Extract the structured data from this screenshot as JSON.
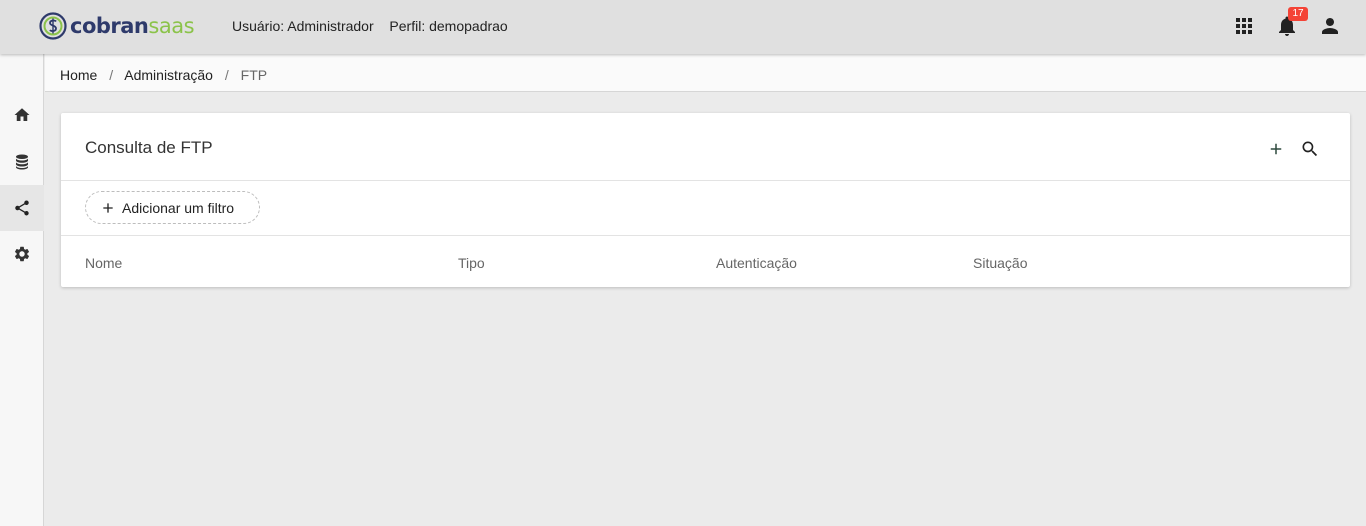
{
  "header": {
    "logo": {
      "part1": "cobran",
      "part2": "saas",
      "color_primary": "#2e3a6b",
      "color_accent": "#8bc34a"
    },
    "user_label": "Usuário:",
    "user_value": "Administrador",
    "profile_label": "Perfil:",
    "profile_value": "demopadrao",
    "icons": [
      "apps-grid-icon",
      "notifications-bell-icon",
      "account-icon"
    ],
    "notification_count": "17",
    "badge_color": "#f44336"
  },
  "sidebar": {
    "items": [
      {
        "icon": "home-icon",
        "active": false
      },
      {
        "icon": "database-icon",
        "active": false
      },
      {
        "icon": "share-icon",
        "active": true
      },
      {
        "icon": "settings-icon",
        "active": false
      }
    ]
  },
  "breadcrumb": {
    "items": [
      "Home",
      "Administração",
      "FTP"
    ],
    "separator": "/"
  },
  "main": {
    "title": "Consulta de FTP",
    "actions": [
      "add-icon",
      "search-icon"
    ],
    "filter_button": "Adicionar um filtro",
    "columns": [
      "Nome",
      "Tipo",
      "Autenticação",
      "Situação"
    ]
  }
}
